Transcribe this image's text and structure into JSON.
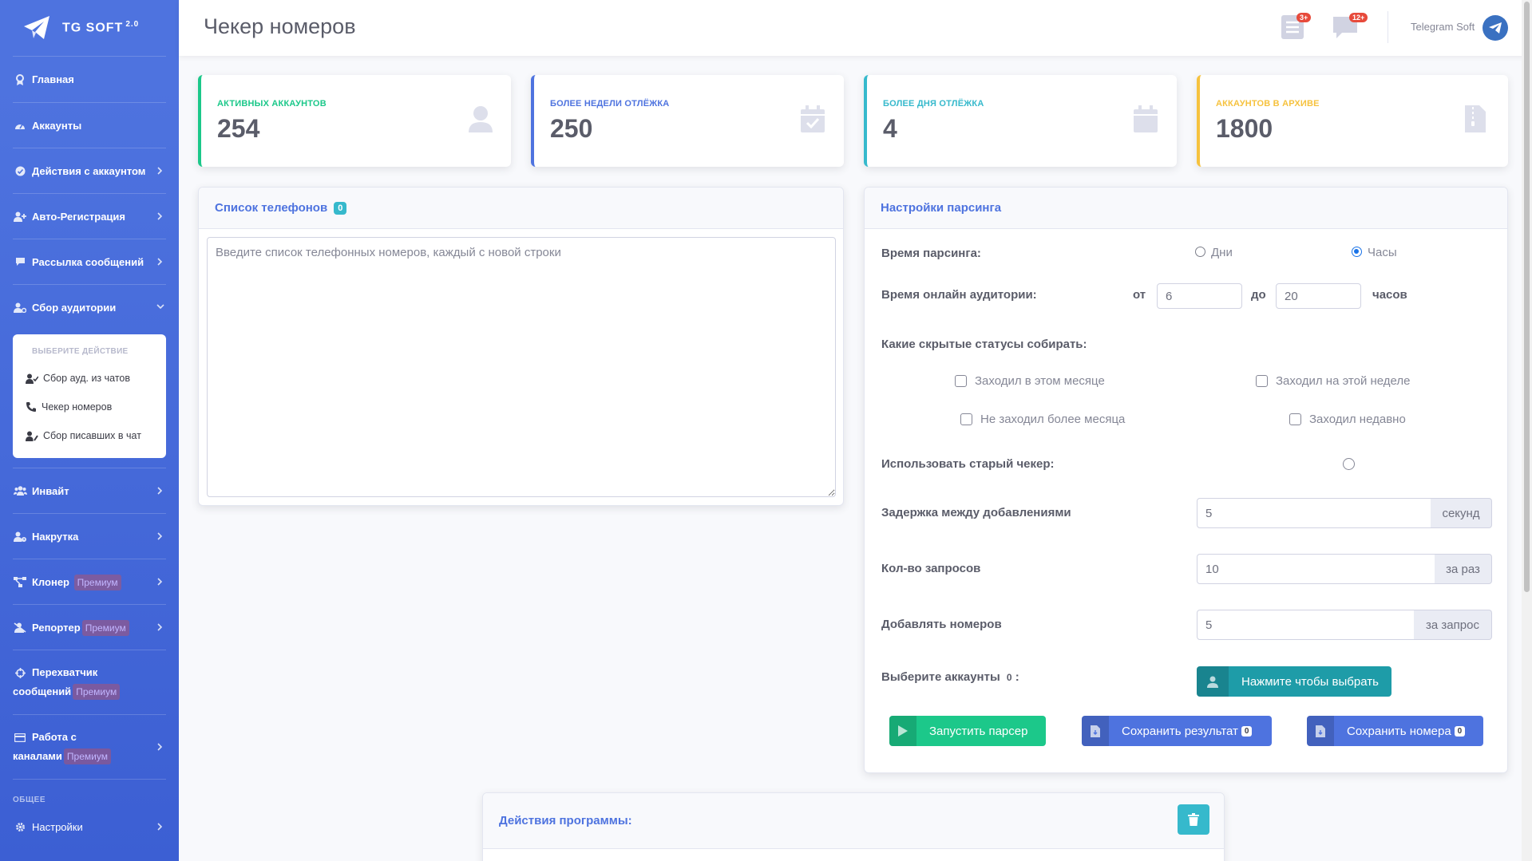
{
  "brand": {
    "name": "TG SOFT",
    "version": "2.0"
  },
  "sidebar": {
    "items": [
      {
        "id": "home",
        "label": "Главная"
      },
      {
        "id": "accounts",
        "label": "Аккаунты"
      },
      {
        "id": "actions",
        "label": "Действия с аккаунтом"
      },
      {
        "id": "autoreg",
        "label": "Авто-Регистрация"
      },
      {
        "id": "mailing",
        "label": "Рассылка сообщений"
      },
      {
        "id": "audience",
        "label": "Сбор аудитории"
      },
      {
        "id": "invite",
        "label": "Инвайт"
      },
      {
        "id": "boost",
        "label": "Накрутка"
      },
      {
        "id": "cloner",
        "label": "Клонер",
        "badge": "Премиум"
      },
      {
        "id": "reporter",
        "label": "Репортер",
        "badge": "Премиум"
      },
      {
        "id": "interceptor",
        "label_line1": "Перехватчик",
        "label_line2": "сообщений",
        "badge": "Премиум"
      },
      {
        "id": "channels",
        "label_line1": "Работа с",
        "label_line2": "каналами",
        "badge": "Премиум"
      }
    ],
    "submenu": {
      "header": "ВЫБЕРИТЕ ДЕЙСТВИЕ",
      "items": [
        {
          "label": "Сбор ауд. из чатов"
        },
        {
          "label": "Чекер номеров"
        },
        {
          "label": "Сбор писавших в чат"
        }
      ]
    },
    "section_general": "ОБЩЕЕ",
    "settings": "Настройки"
  },
  "topbar": {
    "title": "Чекер номеров",
    "alerts_badge": "3+",
    "messages_badge": "12+",
    "user_name": "Telegram Soft"
  },
  "stats": [
    {
      "label": "АКТИВНЫХ АККАУНТОВ",
      "value": "254",
      "color": "#1cc88a"
    },
    {
      "label": "БОЛЕЕ НЕДЕЛИ ОТЛЁЖКА",
      "value": "250",
      "color": "#4e73df"
    },
    {
      "label": "БОЛЕЕ ДНЯ ОТЛЁЖКА",
      "value": "4",
      "color": "#36b9cc"
    },
    {
      "label": "АККАУНТОВ В АРХИВЕ",
      "value": "1800",
      "color": "#f6c23e"
    }
  ],
  "phones": {
    "title": "Список телефонов",
    "count": "0",
    "placeholder": "Введите список телефонных номеров, каждый с новой строки"
  },
  "settings": {
    "title": "Настройки парсинга",
    "parse_time_label": "Время парсинга:",
    "opt_days": "Дни",
    "opt_hours": "Часы",
    "selected": "hours",
    "online_label": "Время онлайн аудитории:",
    "from_label": "от",
    "from_value": "6",
    "to_label": "до",
    "to_value": "20",
    "hours_label": "часов",
    "statuses_label": "Какие скрытые статусы собирать:",
    "statuses": [
      {
        "label": "Заходил в этом месяце",
        "checked": false
      },
      {
        "label": "Заходил на этой неделе",
        "checked": false
      },
      {
        "label": "Не заходил более месяца",
        "checked": false
      },
      {
        "label": "Заходил недавно",
        "checked": false
      }
    ],
    "old_checker_label": "Использовать старый чекер:",
    "delay_label": "Задержка между добавлениями",
    "delay_value": "5",
    "delay_unit": "секунд",
    "requests_label": "Кол-во запросов",
    "requests_value": "10",
    "requests_unit": "за раз",
    "add_label": "Добавлять номеров",
    "add_value": "5",
    "add_unit": "за запрос",
    "accounts_label": "Выберите аккаунты",
    "accounts_count": "0",
    "accounts_colon": ":",
    "select_button": "Нажмите чтобы выбрать",
    "start_button": "Запустить парсер",
    "save_result_button": "Сохранить результат",
    "save_result_count": "0",
    "save_numbers_button": "Сохранить номера",
    "save_numbers_count": "0"
  },
  "program": {
    "title": "Действия программы:"
  }
}
